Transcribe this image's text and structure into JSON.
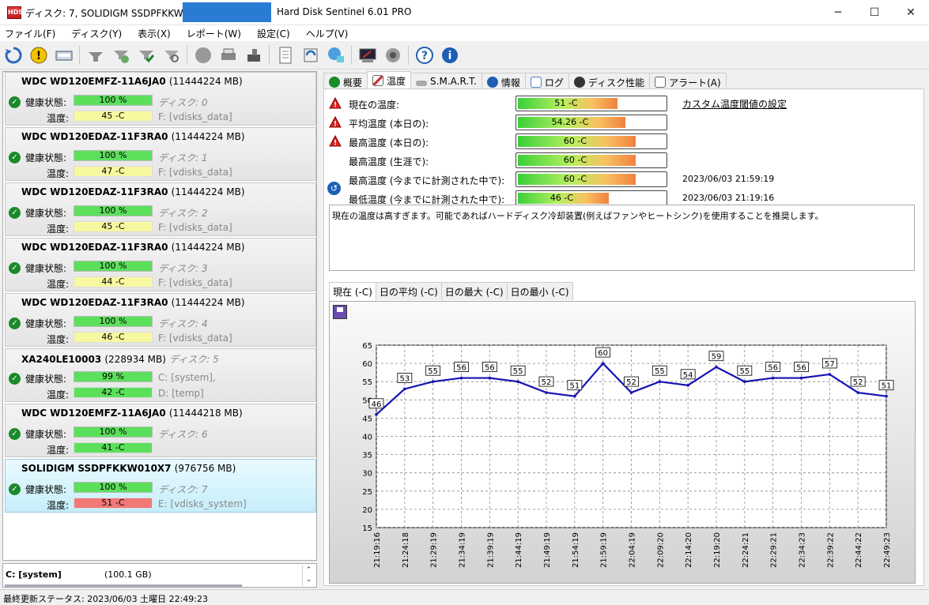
{
  "window": {
    "title": "ディスク: 7, SOLIDIGM SSDPFKKW010X7",
    "app_title": "Hard Disk Sentinel 6.01 PRO",
    "minimize": "─",
    "maximize": "☐",
    "close": "✕"
  },
  "menu": [
    "ファイル(F)",
    "ディスク(Y)",
    "表示(X)",
    "レポート(W)",
    "設定(C)",
    "ヘルプ(V)"
  ],
  "toolbar_icons": [
    "refresh-icon",
    "alert-icon",
    "disk-icon",
    "tool-icon",
    "tool-check-icon",
    "tool-ok-icon",
    "tool-scan-icon",
    "disk-gray-icon",
    "print-icon",
    "drive-icon",
    "report-icon",
    "sync-icon",
    "network-icon",
    "console-icon",
    "sound-icon",
    "help-icon",
    "info-icon"
  ],
  "disks": [
    {
      "name": "WDC WD120EMFZ-11A6JA0",
      "size": "(11444224 MB)",
      "health_label": "健康状態:",
      "health": "100 %",
      "temp_label": "温度:",
      "temp": "45 -C",
      "line1": "ディスク: 0",
      "line2": "F: [vdisks_data]",
      "temp_style": "normal"
    },
    {
      "name": "WDC WD120EDAZ-11F3RA0",
      "size": "(11444224 MB)",
      "health_label": "健康状態:",
      "health": "100 %",
      "temp_label": "温度:",
      "temp": "47 -C",
      "line1": "ディスク: 1",
      "line2": "F: [vdisks_data]",
      "temp_style": "normal"
    },
    {
      "name": "WDC WD120EDAZ-11F3RA0",
      "size": "(11444224 MB)",
      "health_label": "健康状態:",
      "health": "100 %",
      "temp_label": "温度:",
      "temp": "45 -C",
      "line1": "ディスク: 2",
      "line2": "F: [vdisks_data]",
      "temp_style": "normal"
    },
    {
      "name": "WDC WD120EDAZ-11F3RA0",
      "size": "(11444224 MB)",
      "health_label": "健康状態:",
      "health": "100 %",
      "temp_label": "温度:",
      "temp": "44 -C",
      "line1": "ディスク: 3",
      "line2": "F: [vdisks_data]",
      "temp_style": "normal"
    },
    {
      "name": "WDC WD120EDAZ-11F3RA0",
      "size": "(11444224 MB)",
      "health_label": "健康状態:",
      "health": "100 %",
      "temp_label": "温度:",
      "temp": "46 -C",
      "line1": "ディスク: 4",
      "line2": "F: [vdisks_data]",
      "temp_style": "normal"
    },
    {
      "name": "XA240LE10003",
      "size": "(228934 MB)",
      "extra": "ディスク: 5",
      "health_label": "健康状態:",
      "health": "99 %",
      "temp_label": "温度:",
      "temp": "42 -C",
      "line1": "C: [system],",
      "line2": "D: [temp]",
      "temp_style": "green"
    },
    {
      "name": "WDC WD120EMFZ-11A6JA0",
      "size": "(11444218 MB)",
      "health_label": "健康状態:",
      "health": "100 %",
      "temp_label": "温度:",
      "temp": "41 -C",
      "line1": "ディスク: 6",
      "line2": "",
      "temp_style": "green"
    },
    {
      "name": "SOLIDIGM SSDPFKKW010X7",
      "size": "(976756 MB)",
      "health_label": "健康状態:",
      "health": "100 %",
      "temp_label": "温度:",
      "temp": "51 -C",
      "line1": "ディスク: 7",
      "line2": "E: [vdisks_system]",
      "temp_style": "hot"
    }
  ],
  "volume": {
    "name": "C: [system]",
    "size": "(100.1 GB)"
  },
  "status": "最終更新ステータス: 2023/06/03 土曜日 22:49:23",
  "tabs": [
    {
      "label": "概要",
      "icon": "check-icon"
    },
    {
      "label": "温度",
      "icon": "thermometer-icon"
    },
    {
      "label": "S.M.A.R.T.",
      "icon": "smart-icon"
    },
    {
      "label": "情報",
      "icon": "info-icon"
    },
    {
      "label": "ログ",
      "icon": "log-icon"
    },
    {
      "label": "ディスク性能",
      "icon": "performance-icon"
    },
    {
      "label": "アラート(A)",
      "icon": "alert-icon"
    }
  ],
  "temps": [
    {
      "label": "現在の温度:",
      "value": "51 -C",
      "fill": 0.68,
      "warn": true,
      "date": ""
    },
    {
      "label": "平均温度 (本日の):",
      "value": "54.26 -C",
      "fill": 0.73,
      "warn": true,
      "date": ""
    },
    {
      "label": "最高温度 (本日の):",
      "value": "60 -C",
      "fill": 0.8,
      "warn": true,
      "date": ""
    },
    {
      "label": "最高温度 (生涯で):",
      "value": "60 -C",
      "fill": 0.8,
      "warn": false,
      "date": ""
    },
    {
      "label": "最高温度 (今までに計測された中で):",
      "value": "60 -C",
      "fill": 0.8,
      "warn": false,
      "date": "2023/06/03 21:59:19"
    },
    {
      "label": "最低温度 (今までに計測された中で):",
      "value": "46 -C",
      "fill": 0.62,
      "warn": false,
      "date": "2023/06/03 21:19:16"
    }
  ],
  "custom_threshold_link": "カスタム温度閾値の設定",
  "message": "現在の温度は高すぎます。可能であればハードディスク冷却装置(例えばファンやヒートシンク)を使用することを推奨します。",
  "graph_tabs": [
    "現在 (-C)",
    "日の平均 (-C)",
    "日の最大 (-C)",
    "日の最小 (-C)"
  ],
  "chart_data": {
    "type": "line",
    "x": [
      "21:19:16",
      "21:24:18",
      "21:29:19",
      "21:34:19",
      "21:39:19",
      "21:44:19",
      "21:49:19",
      "21:54:19",
      "21:59:19",
      "22:04:19",
      "22:09:20",
      "22:14:20",
      "22:19:20",
      "22:24:21",
      "22:29:21",
      "22:34:23",
      "22:39:22",
      "22:44:22",
      "22:49:23"
    ],
    "values": [
      46,
      53,
      55,
      56,
      56,
      55,
      52,
      51,
      60,
      52,
      55,
      54,
      59,
      55,
      56,
      56,
      57,
      52,
      51
    ],
    "ylim": [
      15,
      65
    ],
    "yticks": [
      15,
      20,
      25,
      30,
      35,
      40,
      45,
      50,
      55,
      60,
      65
    ],
    "grid": true,
    "line_color": "#1414b4"
  }
}
